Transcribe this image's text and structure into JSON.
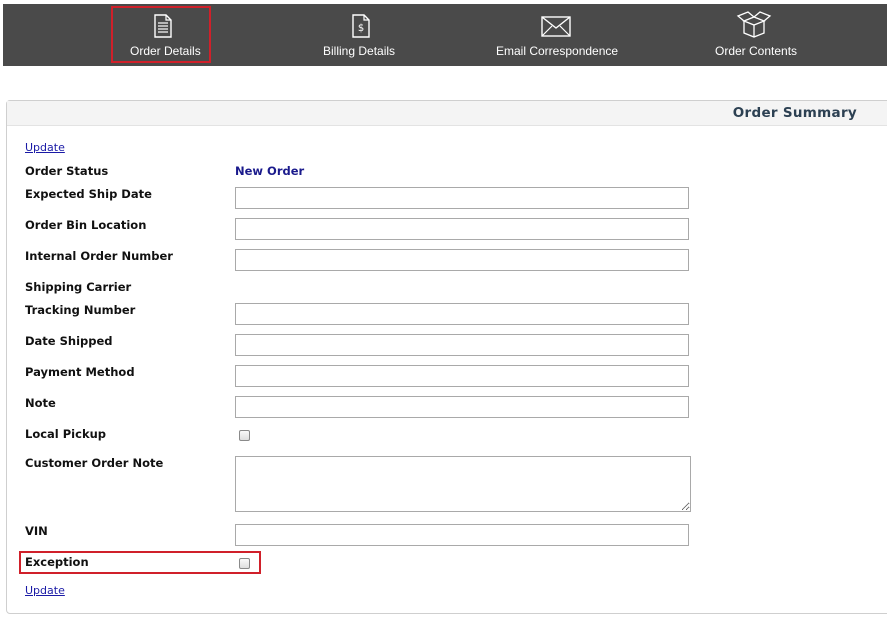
{
  "nav": {
    "tabs": [
      {
        "label": "Order Details",
        "icon": "document-icon",
        "selected": true
      },
      {
        "label": "Billing Details",
        "icon": "dollar-document-icon"
      },
      {
        "label": "Email Correspondence",
        "icon": "envelope-icon"
      },
      {
        "label": "Order Contents",
        "icon": "box-icon"
      }
    ]
  },
  "panel": {
    "title": "Order Summary",
    "update_top": "Update",
    "update_bottom": "Update",
    "order_status_label": "Order Status",
    "order_status_value": "New Order",
    "fields": {
      "expected_ship_date": "Expected Ship Date",
      "order_bin_location": "Order Bin Location",
      "internal_order_number": "Internal Order Number",
      "shipping_carrier": "Shipping Carrier",
      "tracking_number": "Tracking Number",
      "date_shipped": "Date Shipped",
      "payment_method": "Payment Method",
      "note": "Note",
      "local_pickup": "Local Pickup",
      "customer_order_note": "Customer Order Note",
      "vin": "VIN",
      "exception": "Exception"
    }
  },
  "colors": {
    "accent_highlight": "#d0202a",
    "nav_bg": "#4a4a4a",
    "link": "#1a1aa6",
    "status_value": "#1a1a8c"
  }
}
